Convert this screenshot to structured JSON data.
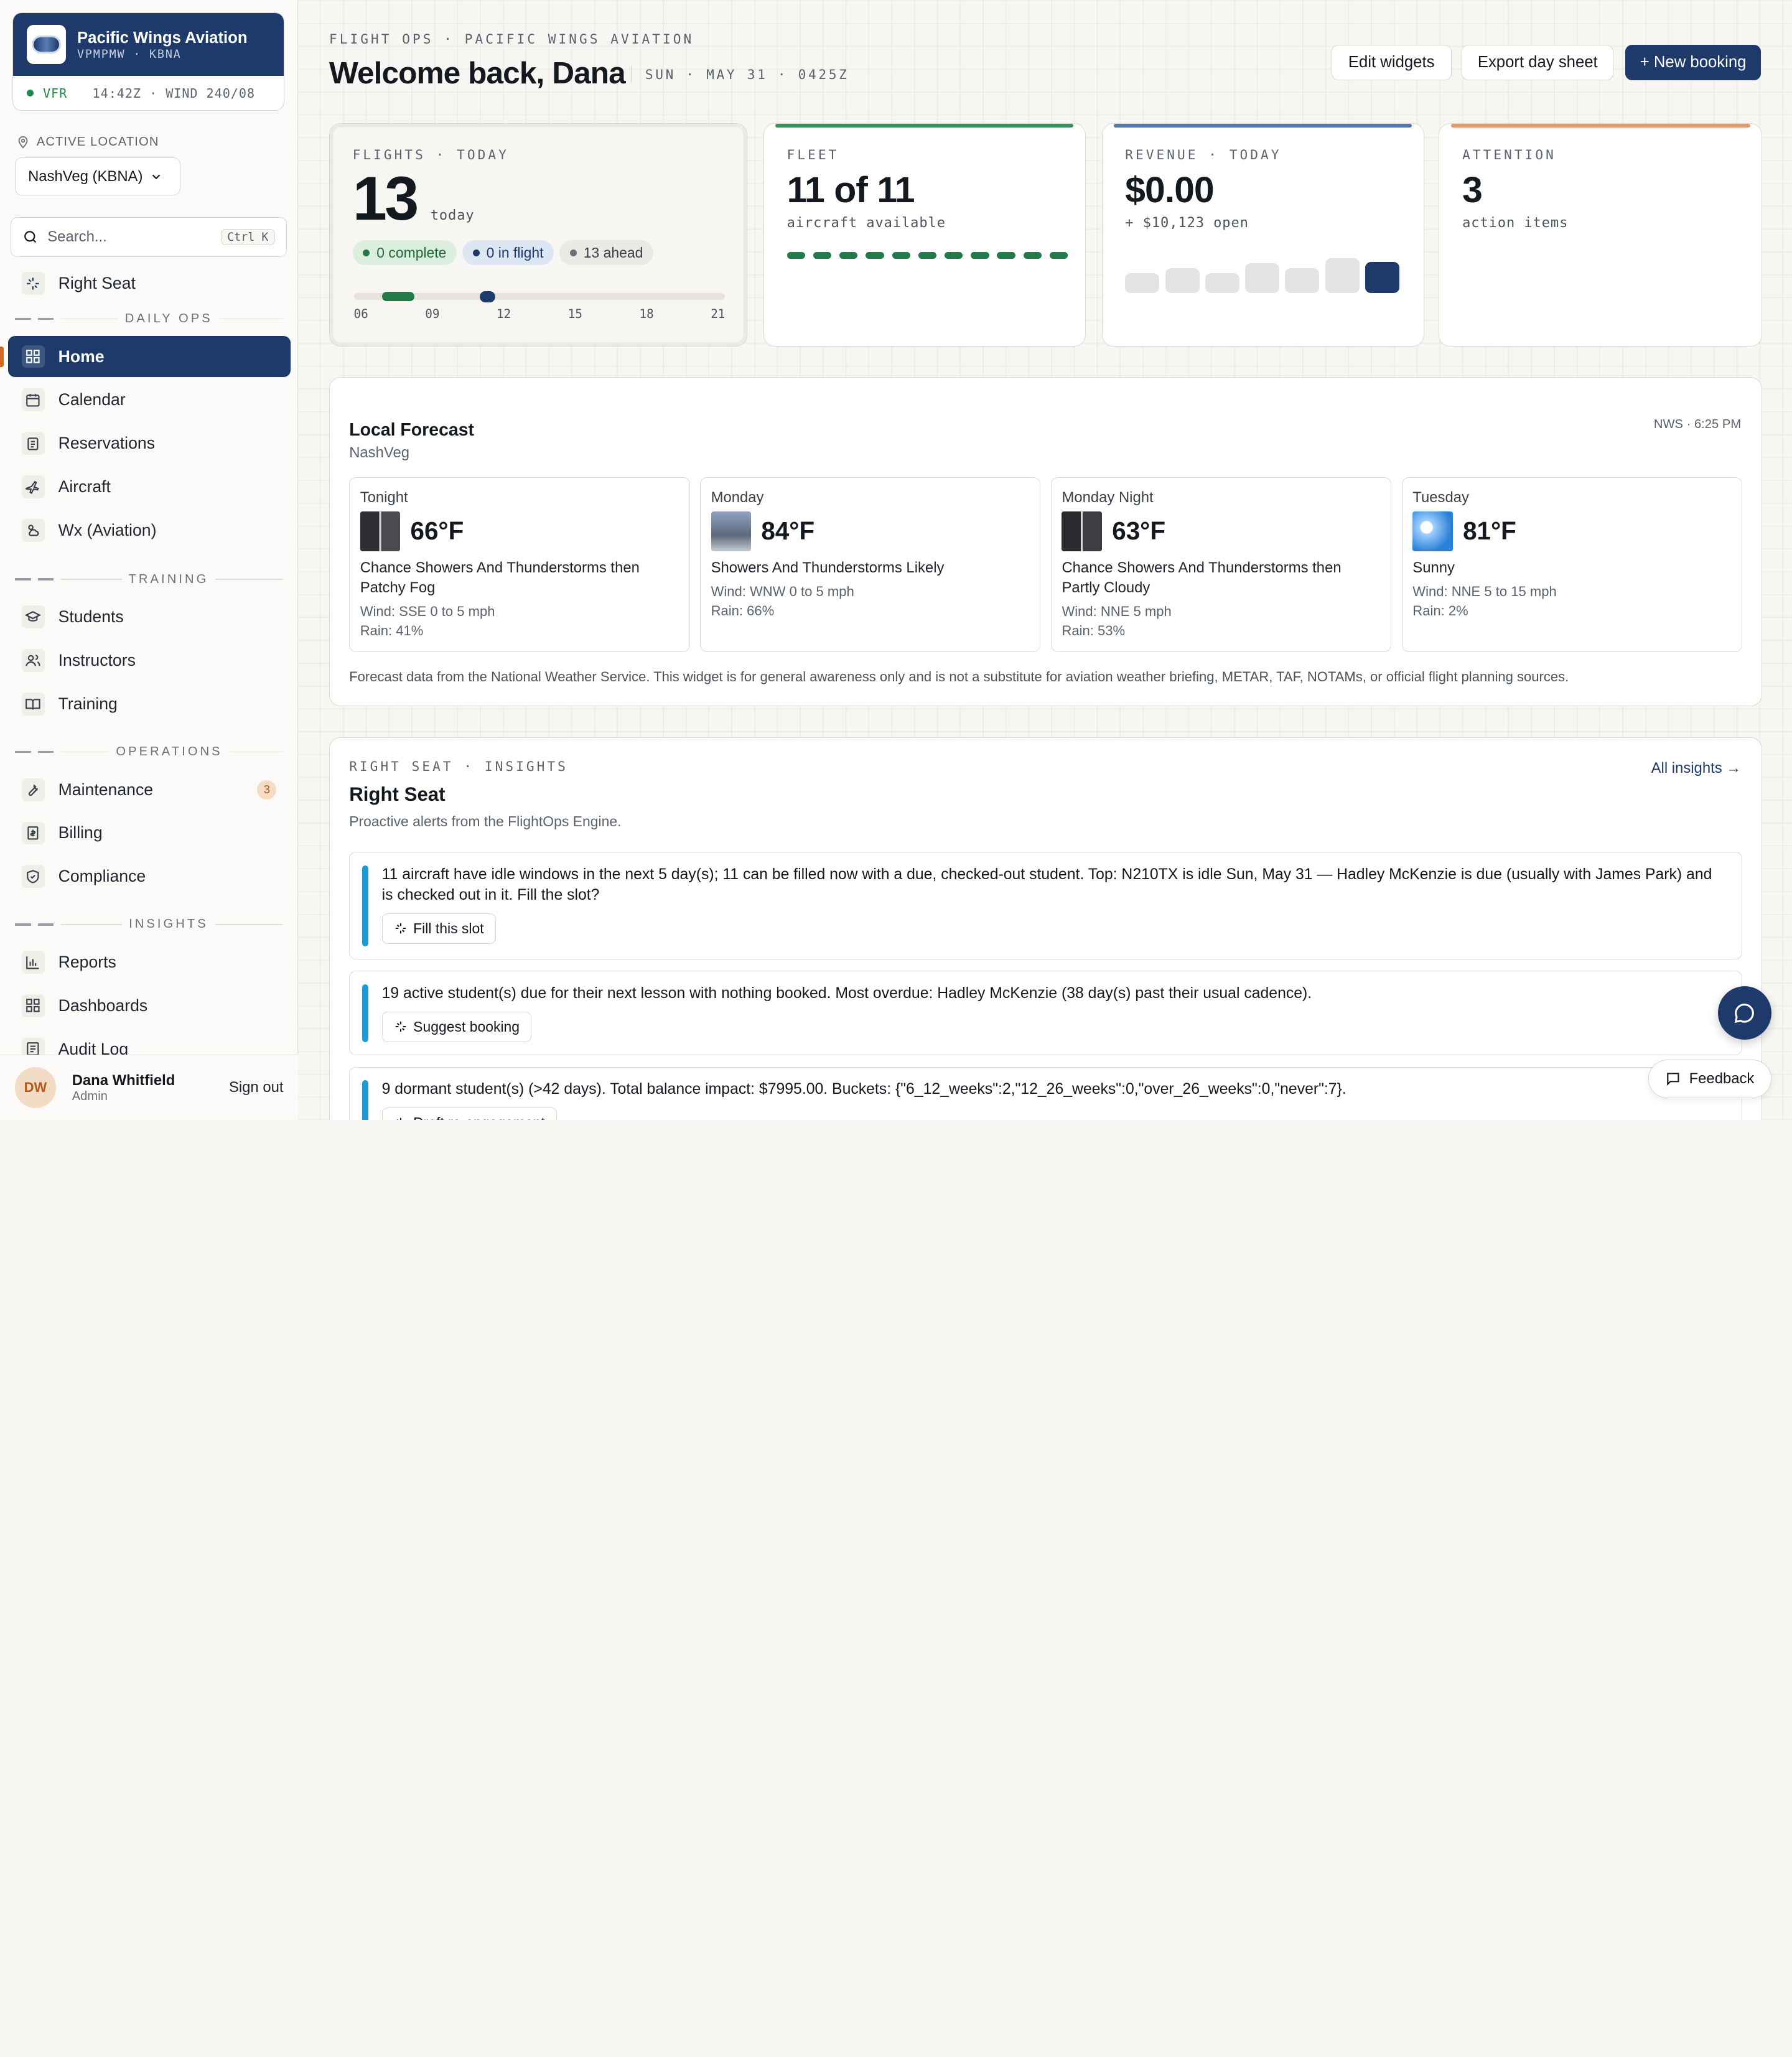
{
  "brand": {
    "name": "Pacific Wings Aviation",
    "codes": "VPMPMW · KBNA",
    "conditions": "VFR",
    "weather_line": "14:42Z · WIND 240/08"
  },
  "location": {
    "label": "ACTIVE LOCATION",
    "value": "NashVeg (KBNA)"
  },
  "search": {
    "placeholder": "Search...",
    "shortcut": "Ctrl K"
  },
  "nav": {
    "right_seat": "Right Seat",
    "sections": {
      "daily_ops": "DAILY OPS",
      "training": "TRAINING",
      "operations": "OPERATIONS",
      "insights": "INSIGHTS"
    },
    "home": "Home",
    "calendar": "Calendar",
    "reservations": "Reservations",
    "aircraft": "Aircraft",
    "wx": "Wx (Aviation)",
    "students": "Students",
    "instructors": "Instructors",
    "training": "Training",
    "maintenance": "Maintenance",
    "maintenance_badge": "3",
    "billing": "Billing",
    "compliance": "Compliance",
    "reports": "Reports",
    "dashboards": "Dashboards",
    "audit_log": "Audit Log"
  },
  "user": {
    "initials": "DW",
    "name": "Dana Whitfield",
    "role": "Admin",
    "signout": "Sign out"
  },
  "header": {
    "eyebrow": "FLIGHT OPS · PACIFIC WINGS AVIATION",
    "welcome": "Welcome back, Dana",
    "date": "SUN · MAY 31 · 0425Z",
    "edit_widgets": "Edit widgets",
    "export": "Export day sheet",
    "new_booking": "+ New booking"
  },
  "stats": {
    "flights": {
      "label": "FLIGHTS · TODAY",
      "value": "13",
      "unit": "today",
      "complete": "0 complete",
      "in_flight": "0 in flight",
      "ahead": "13 ahead",
      "ticks": [
        "06",
        "09",
        "12",
        "15",
        "18",
        "21"
      ]
    },
    "fleet": {
      "label": "FLEET",
      "value": "11 of 11",
      "sub": "aircraft available",
      "available": 11,
      "total": 11
    },
    "revenue": {
      "label": "REVENUE · TODAY",
      "value": "$0.00",
      "sub": "+ $10,123 open",
      "bars": [
        0.55,
        0.68,
        0.55,
        0.82,
        0.68,
        0.95,
        0.85
      ]
    },
    "attention": {
      "label": "ATTENTION",
      "value": "3",
      "sub": "action items"
    }
  },
  "colors": {
    "navy": "#1d3a6b",
    "green": "#217b49",
    "blue_accent": "#1e9ad6",
    "orange": "#d46a1e"
  },
  "forecast": {
    "title": "Local Forecast",
    "location": "NashVeg",
    "source": "NWS · 6:25 PM",
    "periods": [
      {
        "name": "Tonight",
        "temp": "66°F",
        "desc": "Chance Showers And Thunderstorms then Patchy Fog",
        "wind": "Wind: SSE 0 to 5 mph",
        "rain": "Rain: 41%",
        "icon": "storm-fog-icon"
      },
      {
        "name": "Monday",
        "temp": "84°F",
        "desc": "Showers And Thunderstorms Likely",
        "wind": "Wind: WNW 0 to 5 mph",
        "rain": "Rain: 66%",
        "icon": "storm-icon"
      },
      {
        "name": "Monday Night",
        "temp": "63°F",
        "desc": "Chance Showers And Thunderstorms then Partly Cloudy",
        "wind": "Wind: NNE 5 mph",
        "rain": "Rain: 53%",
        "icon": "storm-night-icon"
      },
      {
        "name": "Tuesday",
        "temp": "81°F",
        "desc": "Sunny",
        "wind": "Wind: NNE 5 to 15 mph",
        "rain": "Rain: 2%",
        "icon": "sunny-icon"
      }
    ],
    "footer": "Forecast data from the National Weather Service. This widget is for general awareness only and is not a substitute for aviation weather briefing, METAR, TAF, NOTAMs, or official flight planning sources."
  },
  "insights": {
    "eyebrow": "RIGHT SEAT · INSIGHTS",
    "title": "Right Seat",
    "sub": "Proactive alerts from the FlightOps Engine.",
    "link": "All insights →",
    "alerts": [
      {
        "text": "11 aircraft have idle windows in the next 5 day(s); 11 can be filled now with a due, checked-out student. Top: N210TX is idle Sun, May 31 — Hadley McKenzie is due (usually with James Park) and is checked out in it. Fill the slot?",
        "action": "Fill this slot"
      },
      {
        "text": "19 active student(s) due for their next lesson with nothing booked. Most overdue: Hadley McKenzie (38 day(s) past their usual cadence).",
        "action": "Suggest booking"
      },
      {
        "text": "9 dormant student(s) (>42 days). Total balance impact: $7995.00. Buckets: {\"6_12_weeks\":2,\"12_26_weeks\":0,\"over_26_weeks\":0,\"never\":7}.",
        "action": "Draft re-engagement"
      }
    ]
  },
  "feedback": "Feedback"
}
